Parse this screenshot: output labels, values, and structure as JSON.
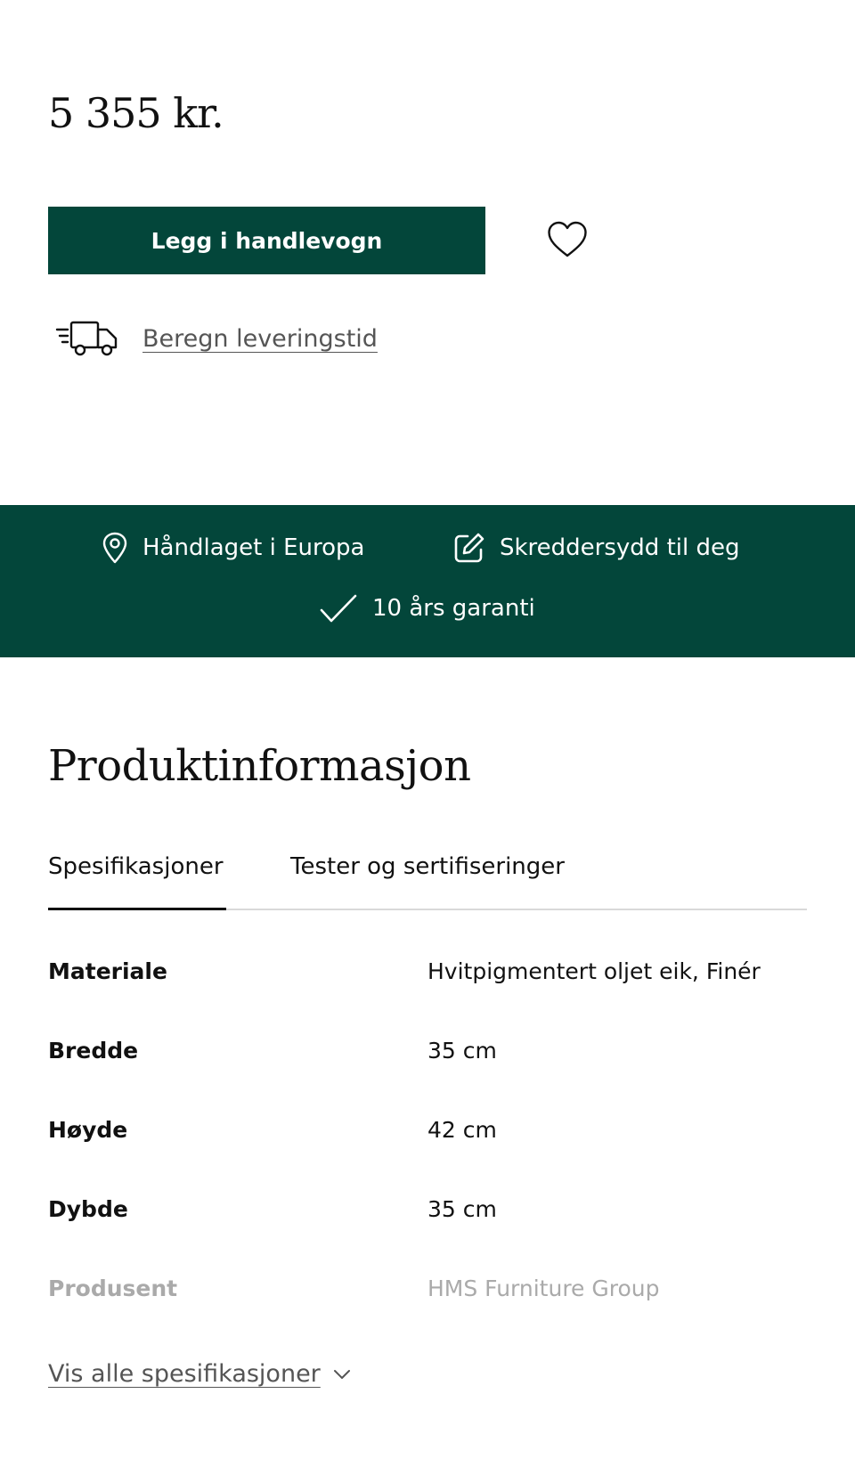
{
  "product": {
    "price": "5 355 kr.",
    "add_to_cart_label": "Legg i handlevogn",
    "delivery_link_label": "Beregn leveringstid"
  },
  "usps": [
    {
      "icon": "location-pin-icon",
      "label": "Håndlaget i Europa"
    },
    {
      "icon": "edit-icon",
      "label": "Skreddersydd til deg"
    },
    {
      "icon": "checkmark-icon",
      "label": "10 års garanti"
    }
  ],
  "product_info": {
    "title": "Produktinformasjon",
    "tabs": [
      {
        "label": "Spesifikasjoner",
        "active": true
      },
      {
        "label": "Tester og sertifiseringer",
        "active": false
      }
    ],
    "specs": [
      {
        "label": "Materiale",
        "value": "Hvitpigmentert oljet eik, Finér"
      },
      {
        "label": "Bredde",
        "value": "35 cm"
      },
      {
        "label": "Høyde",
        "value": "42 cm"
      },
      {
        "label": "Dybde",
        "value": "35 cm"
      },
      {
        "label": "Produsent",
        "value": "HMS Furniture Group"
      }
    ],
    "show_all_label": "Vis alle spesifikasjoner"
  },
  "colors": {
    "brand_green": "#03463a",
    "text": "#111111",
    "link_gray": "#555555",
    "faded_text": "#aaaaaa"
  }
}
